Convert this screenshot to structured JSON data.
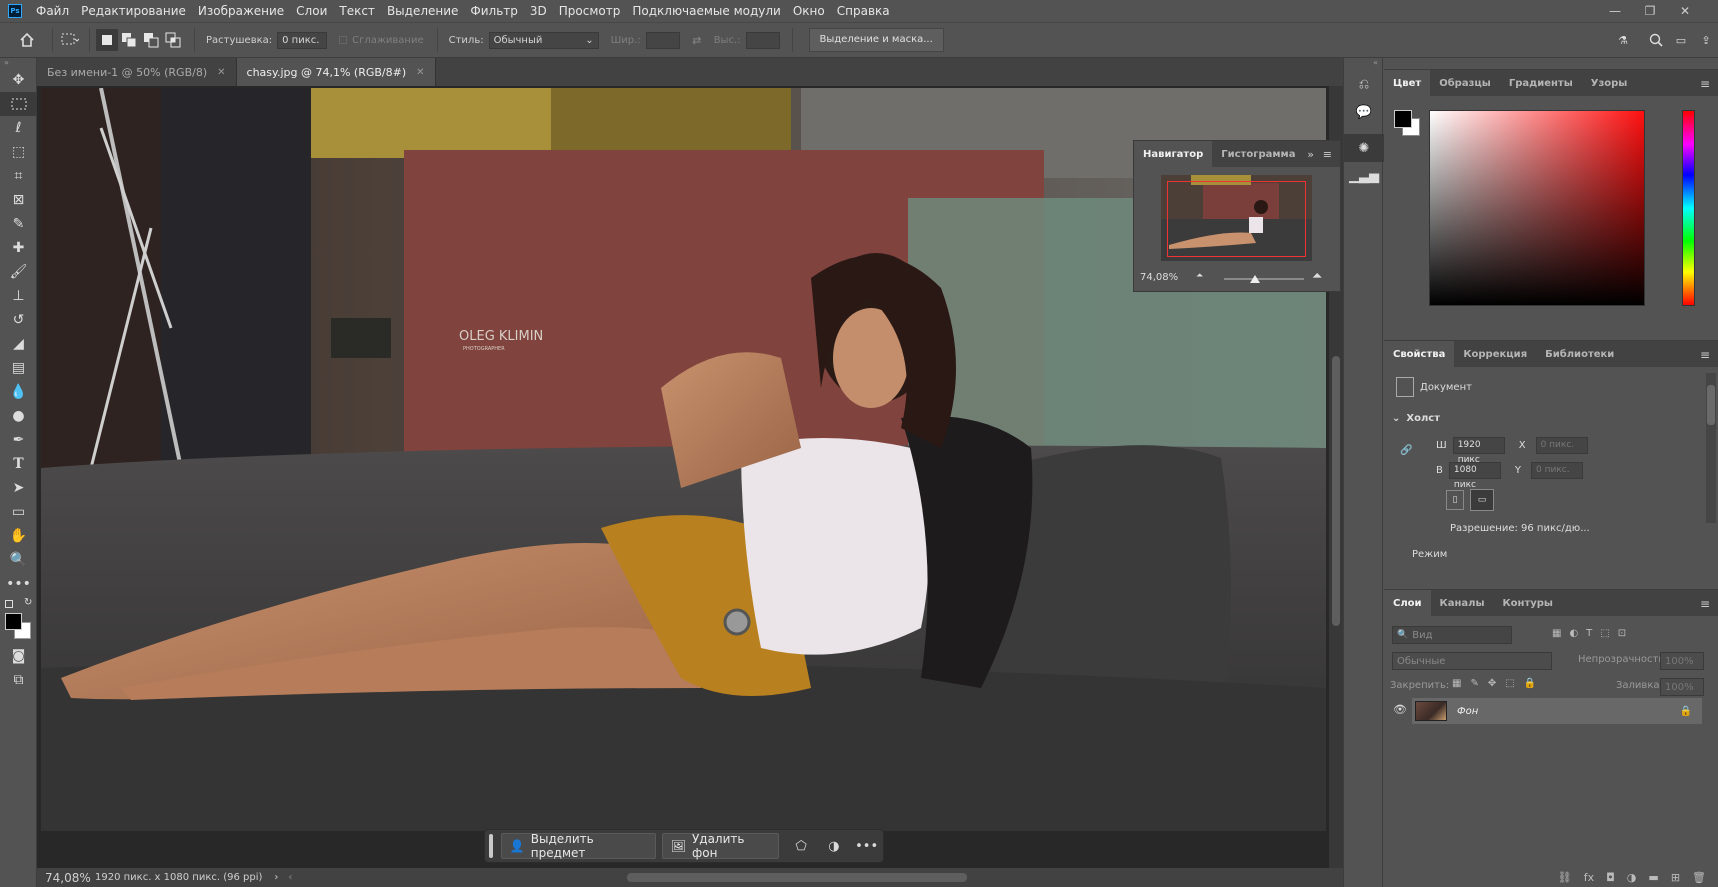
{
  "app": {
    "logo": "Ps",
    "menu": [
      "Файл",
      "Редактирование",
      "Изображение",
      "Слои",
      "Текст",
      "Выделение",
      "Фильтр",
      "3D",
      "Просмотр",
      "Подключаемые модули",
      "Окно",
      "Справка"
    ],
    "window_controls": [
      "minimize-icon",
      "maximize-icon",
      "close-icon"
    ]
  },
  "options": {
    "feather_label": "Растушевка:",
    "feather_value": "0 пикс.",
    "antialias_label": "Сглаживание",
    "style_label": "Стиль:",
    "style_value": "Обычный",
    "width_label": "Шир.:",
    "height_label": "Выс.:",
    "select_mask_button": "Выделение и маска..."
  },
  "tabs": [
    {
      "label": "Без имени-1 @ 50% (RGB/8)",
      "active": false
    },
    {
      "label": "chasy.jpg @ 74,1% (RGB/8#)",
      "active": true
    }
  ],
  "canvas": {
    "watermark": "OLEG KLIMIN",
    "watermark_sub": "PHOTOGRAPHER"
  },
  "context_bar": {
    "select_subject": "Выделить предмет",
    "remove_bg": "Удалить фон"
  },
  "status": {
    "zoom": "74,08%",
    "doc_info": "1920 пикс. x 1080 пикс. (96 ppi)"
  },
  "navigator": {
    "tabs": [
      "Навигатор",
      "Гистограмма"
    ],
    "zoom": "74,08%",
    "zoom_fraction": 0.74
  },
  "color_panel": {
    "tabs": [
      "Цвет",
      "Образцы",
      "Градиенты",
      "Узоры"
    ],
    "foreground": "#000000",
    "background": "#ffffff"
  },
  "properties": {
    "tabs": [
      "Свойства",
      "Коррекция",
      "Библиотеки"
    ],
    "doc_label": "Документ",
    "section": "Холст",
    "w_label": "Ш",
    "w_value": "1920 пикс",
    "h_label": "В",
    "h_value": "1080 пикс",
    "x_label": "X",
    "x_placeholder": "0 пикс.",
    "y_label": "Y",
    "y_placeholder": "0 пикс.",
    "resolution": "Разрешение: 96 пикс/дю...",
    "mode": "Режим"
  },
  "layers": {
    "tabs": [
      "Слои",
      "Каналы",
      "Контуры"
    ],
    "search_placeholder": "Вид",
    "blend_mode": "Обычные",
    "opacity_label": "Непрозрачность:",
    "opacity_value": "100%",
    "lock_label": "Закрепить:",
    "fill_label": "Заливка:",
    "fill_value": "100%",
    "items": [
      {
        "name": "Фон"
      }
    ]
  }
}
